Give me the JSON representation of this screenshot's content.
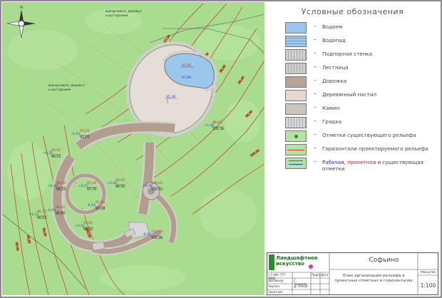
{
  "plan": {
    "zone_labels": [
      {
        "text": "выкорчевать деревья и кустарники"
      },
      {
        "text": "выкорчевать деревья и кустарники"
      }
    ],
    "pond_marks": {
      "red": "97,85",
      "blue": "97,89"
    },
    "deck_marks": {
      "red": "95,69",
      "blue": "95,39"
    },
    "levels": [
      {
        "red": "97,25",
        "blue": "-0,15",
        "black": "97,15"
      },
      {
        "red": "98,89",
        "blue": "+2,48",
        "black": "100,38"
      },
      {
        "red": "95,95",
        "blue": "+0,35",
        "black": "96,53"
      },
      {
        "red": "96,55",
        "blue": "+0,43",
        "black": "96,53"
      },
      {
        "red": "96,45",
        "blue": "-0,29",
        "black": "96,85"
      },
      {
        "red": "97,30",
        "blue": "+0,17",
        "black": "97,70"
      },
      {
        "red": "97,89",
        "blue": "-0,14",
        "black": "96,08"
      },
      {
        "red": "100,05",
        "blue": "+0,48",
        "black": "100,53"
      },
      {
        "red": "96,71",
        "blue": "+1,15",
        "black": "96,53"
      },
      {
        "red": "95,85",
        "blue": "+0,53",
        "black": "96,43"
      },
      {
        "red": "100,29",
        "blue": "-0,02",
        "black": "100,38"
      },
      {
        "red": "96,65",
        "blue": "+0,40",
        "black": "96,50"
      }
    ],
    "contour_labels": [
      "97,00",
      "97,50",
      "98,00",
      "98,50",
      "99,00",
      "99,50",
      "100,00",
      "96,50",
      "96,00",
      "95,50",
      "95,00",
      "100,50"
    ]
  },
  "legend": {
    "title": "Условные обозначения",
    "items": [
      {
        "label": "Водоем",
        "fill": "#9cc7ec"
      },
      {
        "label": "Водопад",
        "fill": "#9cc7ec"
      },
      {
        "label": "Подпорная стенка",
        "fill": "#d2d2d2"
      },
      {
        "label": "Лестница",
        "fill": "#cfcfcf"
      },
      {
        "label": "Дорожка",
        "fill": "#b8a494"
      },
      {
        "label": "Деревянный настил",
        "fill": "#e4d8d0"
      },
      {
        "label": "Камин",
        "fill": "#cdc4bf"
      },
      {
        "label": "Грядка",
        "fill": "#d7d7d7"
      },
      {
        "label": "Отметки существующего рельефа",
        "fill": "#b5e3a4"
      },
      {
        "label": "Горизонтали проектируемого рельефа",
        "fill": "#b5e3a4"
      }
    ],
    "last_item": {
      "part1": "Рабочая",
      "sep1": ", ",
      "part2": "проектная",
      "part3": " и существующая отметки"
    }
  },
  "titleblock": {
    "logo_line1": "Ландшафтное",
    "logo_line2": "искусство",
    "phone": "+7-495-777-7880",
    "object_name": "Софьино",
    "sheet_title": "План организации рельефа в проектных отметках и горизонталях",
    "scale_label": "Масштаб",
    "scale_value": "1:100",
    "col_sign": "Подпись",
    "col_date": "Дата",
    "rows": [
      {
        "role": "Дизайнер",
        "name": "С. Чумаков"
      },
      {
        "role": "Чертил",
        "name": "Д. Ляпов"
      },
      {
        "role": "Заказчик",
        "name": ""
      }
    ]
  },
  "colors": {
    "grass": "#a9dc8f",
    "border": "#555555",
    "contour_design": "#c23b22",
    "water": "#9cc7ec",
    "path": "#b29e8c",
    "deck": "#e6ddd6"
  }
}
